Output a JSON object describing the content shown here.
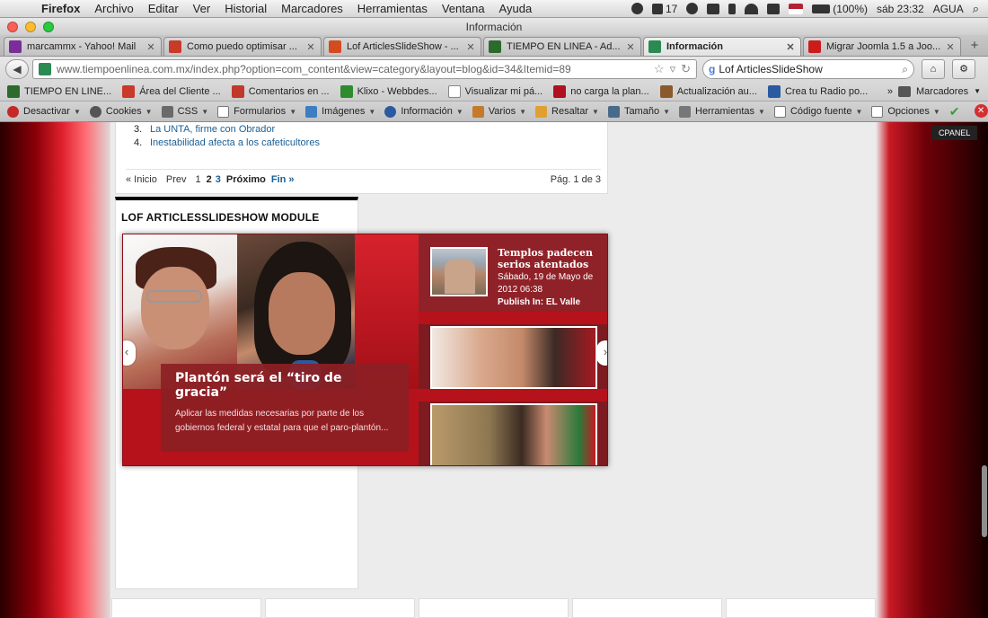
{
  "menubar": {
    "app": "Firefox",
    "items": [
      "Archivo",
      "Editar",
      "Ver",
      "Historial",
      "Marcadores",
      "Herramientas",
      "Ventana",
      "Ayuda"
    ],
    "status": {
      "adobe": "17",
      "battery": "(100%)",
      "clock": "sáb 23:32",
      "user": "AGUA"
    }
  },
  "window": {
    "title": "Información"
  },
  "tabs": [
    {
      "label": "marcammx - Yahoo! Mail",
      "color": "#7b2d9a"
    },
    {
      "label": "Como puedo optimisar ...",
      "color": "#c83a2a"
    },
    {
      "label": "Lof ArticlesSlideShow - ...",
      "color": "#d44b1f"
    },
    {
      "label": "TIEMPO EN LINEA - Ad...",
      "color": "#2d6a2d"
    },
    {
      "label": "Información",
      "color": "#2a8a52"
    },
    {
      "label": "Migrar Joomla 1.5 a Joo...",
      "color": "#cc1b1b"
    }
  ],
  "nav": {
    "url": "www.tiempoenlinea.com.mx/index.php?option=com_content&view=category&layout=blog&id=34&Itemid=89",
    "search": "Lof ArticlesSlideShow"
  },
  "bookmarks": {
    "items": [
      {
        "label": "TIEMPO EN LINE...",
        "color": "#2d6a2d"
      },
      {
        "label": "Área del Cliente ...",
        "color": "#c83a2a"
      },
      {
        "label": "Comentarios en ...",
        "color": "#c0392b"
      },
      {
        "label": "Klixo - Webbdes...",
        "color": "#2e8b2e"
      },
      {
        "label": "Visualizar mi pá...",
        "color": "#aaaaaa"
      },
      {
        "label": "no carga la plan...",
        "color": "#b01020"
      },
      {
        "label": "Actualización au...",
        "color": "#8a5a2a"
      },
      {
        "label": "Crea tu Radio po...",
        "color": "#2a5aa0"
      }
    ],
    "more": "»",
    "folder": "Marcadores"
  },
  "devbar": {
    "items": [
      "Desactivar",
      "Cookies",
      "CSS",
      "Formularios",
      "Imágenes",
      "Información",
      "Varios",
      "Resaltar",
      "Tamaño",
      "Herramientas",
      "Código fuente",
      "Opciones"
    ]
  },
  "page": {
    "articles": [
      "La UNTA, firme con Obrador",
      "Inestabilidad afecta a los cafeticultores"
    ],
    "article_numbers": [
      "3.",
      "4."
    ],
    "pagination": {
      "first": "« Inicio",
      "prev": "Prev",
      "pages": [
        "1",
        "2",
        "3"
      ],
      "next": "Próximo",
      "last": "Fin »",
      "count": "Pág. 1 de 3"
    },
    "module_title": "LOF ARTICLESSLIDESHOW MODULE",
    "cpanel": "CPANEL"
  },
  "slideshow": {
    "main_title": "Plantón será el “tiro de gracia”",
    "main_text": "Aplicar las medidas necesarias por parte de los gobiernos federal y estatal para que el paro-plantón...",
    "nav_item": {
      "title": "Templos padecen serios atentados",
      "date": "Sábado, 19 de Mayo de 2012 06:38",
      "publish_prefix": "Publish In:",
      "publish_section": "EL Valle"
    }
  }
}
